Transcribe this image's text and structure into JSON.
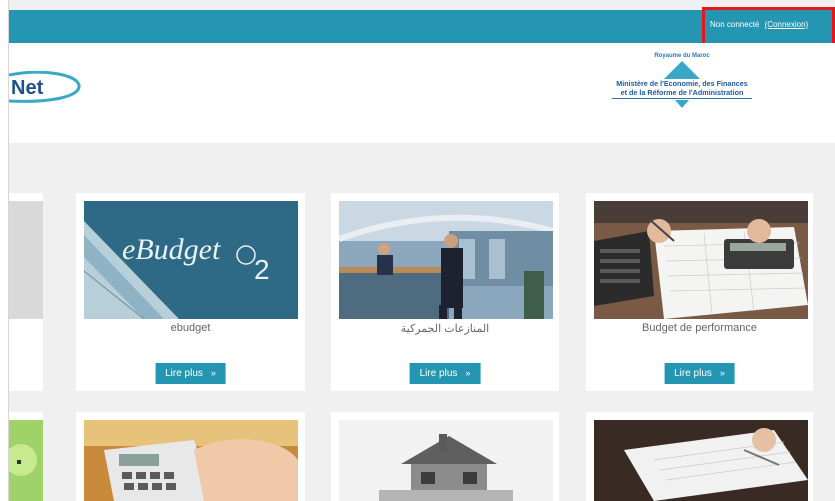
{
  "auth": {
    "status": "Non connecté",
    "login_link": "(Connexion)"
  },
  "header": {
    "logo_text": "Net",
    "ministry_kingdom": "Royaume du Maroc",
    "ministry_line1": "Ministère de l'Economie, des Finances",
    "ministry_line2": "et de la Réforme de l'Administration"
  },
  "cards": [
    {
      "title": "",
      "button": ""
    },
    {
      "title": "ebudget",
      "image_text": "eBudget",
      "image_number": "2",
      "button": "Lire plus",
      "button_icon": "»"
    },
    {
      "title": "المنازعات الجمركية",
      "button": "Lire plus",
      "button_icon": "»"
    },
    {
      "title": "Budget de performance",
      "button": "Lire plus",
      "button_icon": "»"
    }
  ],
  "colors": {
    "topbar": "#2596b2",
    "highlight": "#e8161b",
    "button": "#2596b2"
  }
}
